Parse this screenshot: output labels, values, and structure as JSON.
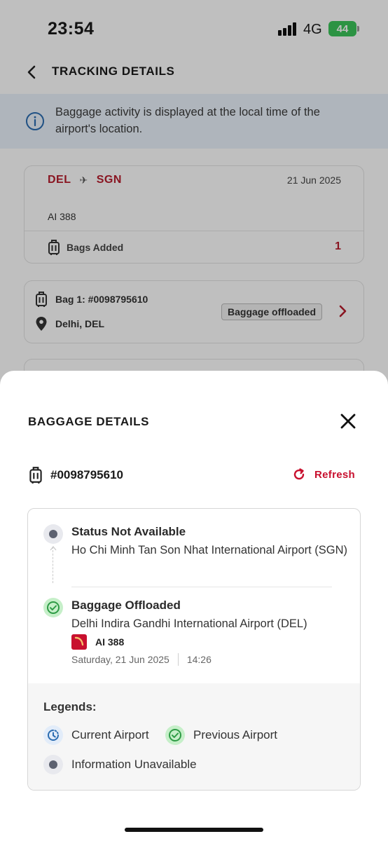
{
  "status_bar": {
    "time": "23:54",
    "network": "4G",
    "battery": "44"
  },
  "header": {
    "title": "TRACKING DETAILS",
    "back_icon": "chevron-left-icon"
  },
  "info_banner": {
    "text": "Baggage activity is displayed at the local time of the airport's location.",
    "icon": "info-icon"
  },
  "flight_card": {
    "origin": "DEL",
    "destination": "SGN",
    "date": "21 Jun 2025",
    "flight_number": "AI 388",
    "bags_label": "Bags Added",
    "bags_count": "1"
  },
  "bag_card": {
    "bag_label": "Bag 1: #0098795610",
    "location": "Delhi, DEL",
    "status": "Baggage offloaded"
  },
  "sheet": {
    "title": "BAGGAGE DETAILS",
    "bag_id": "#0098795610",
    "refresh_label": "Refresh",
    "timeline": [
      {
        "status": "Status Not Available",
        "airport": "Ho Chi Minh Tan Son Nhat International Airport (SGN)",
        "icon": "information-unavailable-icon"
      },
      {
        "status": "Baggage Offloaded",
        "airport": "Delhi Indira Gandhi International Airport (DEL)",
        "flight": "AI 388",
        "date": "Saturday, 21 Jun 2025",
        "time": "14:26",
        "icon": "previous-airport-icon"
      }
    ],
    "legends": {
      "title": "Legends:",
      "current": "Current Airport",
      "previous": "Previous Airport",
      "unavailable": "Information Unavailable"
    }
  },
  "colors": {
    "brand_red": "#c8102e",
    "route_red": "#b71c2c",
    "success_green": "#2e9b45",
    "info_blue": "#2b6cb0"
  }
}
